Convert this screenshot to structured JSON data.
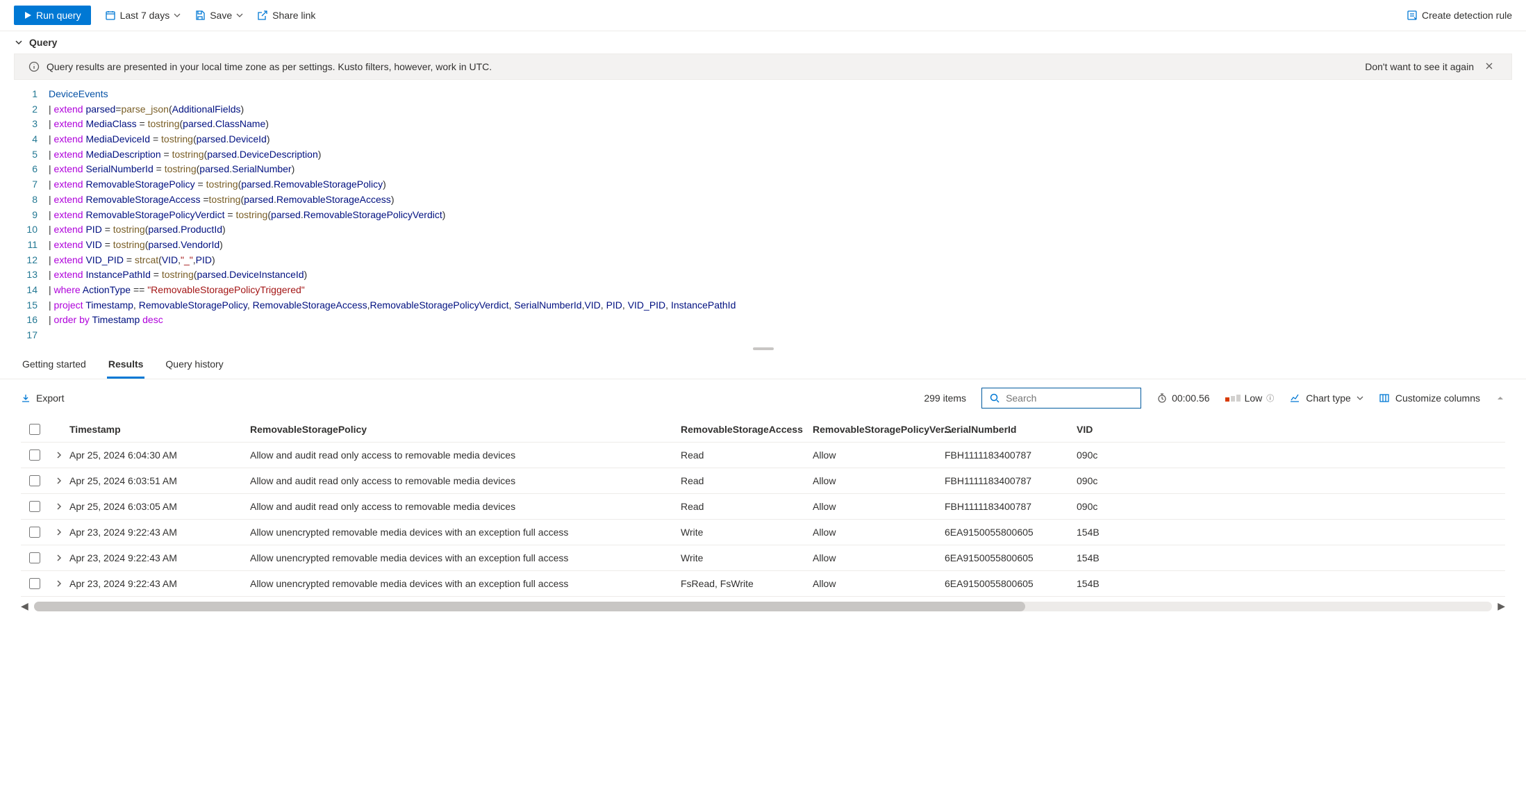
{
  "toolbar": {
    "run_label": "Run query",
    "time_range": "Last 7 days",
    "save_label": "Save",
    "share_label": "Share link",
    "create_rule": "Create detection rule"
  },
  "query_section": {
    "title": "Query"
  },
  "banner": {
    "message": "Query results are presented in your local time zone as per settings. Kusto filters, however, work in UTC.",
    "dismiss_label": "Don't want to see it again"
  },
  "code_lines": [
    [
      [
        "kw-table",
        "DeviceEvents"
      ]
    ],
    [
      [
        "kw-pipe",
        "|·"
      ],
      [
        "kw-op",
        "extend"
      ],
      [
        "kw-plain",
        "·"
      ],
      [
        "kw-ident",
        "parsed"
      ],
      [
        "kw-plain",
        "="
      ],
      [
        "kw-func",
        "parse_json"
      ],
      [
        "kw-plain",
        "("
      ],
      [
        "kw-ident",
        "AdditionalFields"
      ],
      [
        "kw-plain",
        ")"
      ]
    ],
    [
      [
        "kw-pipe",
        "|·"
      ],
      [
        "kw-op",
        "extend"
      ],
      [
        "kw-plain",
        "·"
      ],
      [
        "kw-ident",
        "MediaClass"
      ],
      [
        "kw-plain",
        "·=·"
      ],
      [
        "kw-func",
        "tostring"
      ],
      [
        "kw-plain",
        "("
      ],
      [
        "kw-ident",
        "parsed"
      ],
      [
        "kw-plain",
        "."
      ],
      [
        "kw-ident",
        "ClassName"
      ],
      [
        "kw-plain",
        ")"
      ]
    ],
    [
      [
        "kw-pipe",
        "|·"
      ],
      [
        "kw-op",
        "extend"
      ],
      [
        "kw-plain",
        "·"
      ],
      [
        "kw-ident",
        "MediaDeviceId"
      ],
      [
        "kw-plain",
        "·=·"
      ],
      [
        "kw-func",
        "tostring"
      ],
      [
        "kw-plain",
        "("
      ],
      [
        "kw-ident",
        "parsed"
      ],
      [
        "kw-plain",
        "."
      ],
      [
        "kw-ident",
        "DeviceId"
      ],
      [
        "kw-plain",
        ")"
      ]
    ],
    [
      [
        "kw-pipe",
        "|·"
      ],
      [
        "kw-op",
        "extend"
      ],
      [
        "kw-plain",
        "·"
      ],
      [
        "kw-ident",
        "MediaDescription"
      ],
      [
        "kw-plain",
        "·=·"
      ],
      [
        "kw-func",
        "tostring"
      ],
      [
        "kw-plain",
        "("
      ],
      [
        "kw-ident",
        "parsed"
      ],
      [
        "kw-plain",
        "."
      ],
      [
        "kw-ident",
        "DeviceDescription"
      ],
      [
        "kw-plain",
        ")"
      ]
    ],
    [
      [
        "kw-pipe",
        "|·"
      ],
      [
        "kw-op",
        "extend"
      ],
      [
        "kw-plain",
        "·"
      ],
      [
        "kw-ident",
        "SerialNumberId"
      ],
      [
        "kw-plain",
        "·=·"
      ],
      [
        "kw-func",
        "tostring"
      ],
      [
        "kw-plain",
        "("
      ],
      [
        "kw-ident",
        "parsed"
      ],
      [
        "kw-plain",
        "."
      ],
      [
        "kw-ident",
        "SerialNumber"
      ],
      [
        "kw-plain",
        ")"
      ]
    ],
    [
      [
        "kw-pipe",
        "|·"
      ],
      [
        "kw-op",
        "extend"
      ],
      [
        "kw-plain",
        "·"
      ],
      [
        "kw-ident",
        "RemovableStoragePolicy"
      ],
      [
        "kw-plain",
        "·=·"
      ],
      [
        "kw-func",
        "tostring"
      ],
      [
        "kw-plain",
        "("
      ],
      [
        "kw-ident",
        "parsed"
      ],
      [
        "kw-plain",
        "."
      ],
      [
        "kw-ident",
        "RemovableStoragePolicy"
      ],
      [
        "kw-plain",
        ")"
      ]
    ],
    [
      [
        "kw-pipe",
        "|·"
      ],
      [
        "kw-op",
        "extend"
      ],
      [
        "kw-plain",
        "·"
      ],
      [
        "kw-ident",
        "RemovableStorageAccess"
      ],
      [
        "kw-plain",
        "·="
      ],
      [
        "kw-func",
        "tostring"
      ],
      [
        "kw-plain",
        "("
      ],
      [
        "kw-ident",
        "parsed"
      ],
      [
        "kw-plain",
        "."
      ],
      [
        "kw-ident",
        "RemovableStorageAccess"
      ],
      [
        "kw-plain",
        ")"
      ]
    ],
    [
      [
        "kw-pipe",
        "|·"
      ],
      [
        "kw-op",
        "extend"
      ],
      [
        "kw-plain",
        "·"
      ],
      [
        "kw-ident",
        "RemovableStoragePolicyVerdict"
      ],
      [
        "kw-plain",
        "·=·"
      ],
      [
        "kw-func",
        "tostring"
      ],
      [
        "kw-plain",
        "("
      ],
      [
        "kw-ident",
        "parsed"
      ],
      [
        "kw-plain",
        "."
      ],
      [
        "kw-ident",
        "RemovableStoragePolicyVerdict"
      ],
      [
        "kw-plain",
        ")"
      ]
    ],
    [
      [
        "kw-pipe",
        "|·"
      ],
      [
        "kw-op",
        "extend"
      ],
      [
        "kw-plain",
        "·"
      ],
      [
        "kw-ident",
        "PID"
      ],
      [
        "kw-plain",
        "·=·"
      ],
      [
        "kw-func",
        "tostring"
      ],
      [
        "kw-plain",
        "("
      ],
      [
        "kw-ident",
        "parsed"
      ],
      [
        "kw-plain",
        "."
      ],
      [
        "kw-ident",
        "ProductId"
      ],
      [
        "kw-plain",
        ")"
      ]
    ],
    [
      [
        "kw-pipe",
        "|·"
      ],
      [
        "kw-op",
        "extend"
      ],
      [
        "kw-plain",
        "·"
      ],
      [
        "kw-ident",
        "VID"
      ],
      [
        "kw-plain",
        "·=·"
      ],
      [
        "kw-func",
        "tostring"
      ],
      [
        "kw-plain",
        "("
      ],
      [
        "kw-ident",
        "parsed"
      ],
      [
        "kw-plain",
        "."
      ],
      [
        "kw-ident",
        "VendorId"
      ],
      [
        "kw-plain",
        ")"
      ]
    ],
    [
      [
        "kw-pipe",
        "|·"
      ],
      [
        "kw-op",
        "extend"
      ],
      [
        "kw-plain",
        "·"
      ],
      [
        "kw-ident",
        "VID_PID"
      ],
      [
        "kw-plain",
        "·=·"
      ],
      [
        "kw-func",
        "strcat"
      ],
      [
        "kw-plain",
        "("
      ],
      [
        "kw-ident",
        "VID"
      ],
      [
        "kw-plain",
        ","
      ],
      [
        "kw-str",
        "\"_\""
      ],
      [
        "kw-plain",
        ","
      ],
      [
        "kw-ident",
        "PID"
      ],
      [
        "kw-plain",
        ")"
      ]
    ],
    [
      [
        "kw-pipe",
        "|·"
      ],
      [
        "kw-op",
        "extend"
      ],
      [
        "kw-plain",
        "·"
      ],
      [
        "kw-ident",
        "InstancePathId"
      ],
      [
        "kw-plain",
        "·=·"
      ],
      [
        "kw-func",
        "tostring"
      ],
      [
        "kw-plain",
        "("
      ],
      [
        "kw-ident",
        "parsed"
      ],
      [
        "kw-plain",
        "."
      ],
      [
        "kw-ident",
        "DeviceInstanceId"
      ],
      [
        "kw-plain",
        ")"
      ]
    ],
    [
      [
        "kw-pipe",
        "|·"
      ],
      [
        "kw-op",
        "where"
      ],
      [
        "kw-plain",
        "·"
      ],
      [
        "kw-ident",
        "ActionType"
      ],
      [
        "kw-plain",
        "·==·"
      ],
      [
        "kw-str",
        "\"RemovableStoragePolicyTriggered\""
      ]
    ],
    [
      [
        "kw-pipe",
        "|·"
      ],
      [
        "kw-op",
        "project"
      ],
      [
        "kw-plain",
        "·"
      ],
      [
        "kw-ident",
        "Timestamp"
      ],
      [
        "kw-plain",
        ",·"
      ],
      [
        "kw-ident",
        "RemovableStoragePolicy"
      ],
      [
        "kw-plain",
        ",·"
      ],
      [
        "kw-ident",
        "RemovableStorageAccess"
      ],
      [
        "kw-plain",
        ","
      ],
      [
        "kw-ident",
        "RemovableStoragePolicyVerdict"
      ],
      [
        "kw-plain",
        ",·"
      ],
      [
        "kw-ident",
        "SerialNumberId"
      ],
      [
        "kw-plain",
        ","
      ],
      [
        "kw-ident",
        "VID"
      ],
      [
        "kw-plain",
        ",·"
      ],
      [
        "kw-ident",
        "PID"
      ],
      [
        "kw-plain",
        ",·"
      ],
      [
        "kw-ident",
        "VID_PID"
      ],
      [
        "kw-plain",
        ",·"
      ],
      [
        "kw-ident",
        "InstancePathId"
      ]
    ],
    [
      [
        "kw-pipe",
        "|·"
      ],
      [
        "kw-op",
        "order by"
      ],
      [
        "kw-plain",
        "·"
      ],
      [
        "kw-ident",
        "Timestamp"
      ],
      [
        "kw-plain",
        "·"
      ],
      [
        "kw-op",
        "desc"
      ]
    ],
    [
      [
        "kw-plain",
        ""
      ]
    ]
  ],
  "result_tabs": {
    "getting_started": "Getting started",
    "results": "Results",
    "query_history": "Query history"
  },
  "results_bar": {
    "export_label": "Export",
    "item_count": "299 items",
    "search_placeholder": "Search",
    "timer": "00:00.56",
    "cost_label": "Low",
    "chart_label": "Chart type",
    "columns_label": "Customize columns"
  },
  "columns": {
    "timestamp": "Timestamp",
    "policy": "RemovableStoragePolicy",
    "access": "RemovableStorageAccess",
    "verdict": "RemovableStoragePolicyVer...",
    "serial": "SerialNumberId",
    "vid": "VID"
  },
  "rows": [
    {
      "ts": "Apr 25, 2024 6:04:30 AM",
      "policy": "Allow and audit read only access to removable media devices",
      "access": "Read",
      "verdict": "Allow",
      "serial": "FBH1111183400787",
      "vid": "090c"
    },
    {
      "ts": "Apr 25, 2024 6:03:51 AM",
      "policy": "Allow and audit read only access to removable media devices",
      "access": "Read",
      "verdict": "Allow",
      "serial": "FBH1111183400787",
      "vid": "090c"
    },
    {
      "ts": "Apr 25, 2024 6:03:05 AM",
      "policy": "Allow and audit read only access to removable media devices",
      "access": "Read",
      "verdict": "Allow",
      "serial": "FBH1111183400787",
      "vid": "090c"
    },
    {
      "ts": "Apr 23, 2024 9:22:43 AM",
      "policy": "Allow unencrypted removable media devices with an exception full access",
      "access": "Write",
      "verdict": "Allow",
      "serial": "6EA9150055800605",
      "vid": "154B"
    },
    {
      "ts": "Apr 23, 2024 9:22:43 AM",
      "policy": "Allow unencrypted removable media devices with an exception full access",
      "access": "Write",
      "verdict": "Allow",
      "serial": "6EA9150055800605",
      "vid": "154B"
    },
    {
      "ts": "Apr 23, 2024 9:22:43 AM",
      "policy": "Allow unencrypted removable media devices with an exception full access",
      "access": "FsRead, FsWrite",
      "verdict": "Allow",
      "serial": "6EA9150055800605",
      "vid": "154B"
    }
  ]
}
